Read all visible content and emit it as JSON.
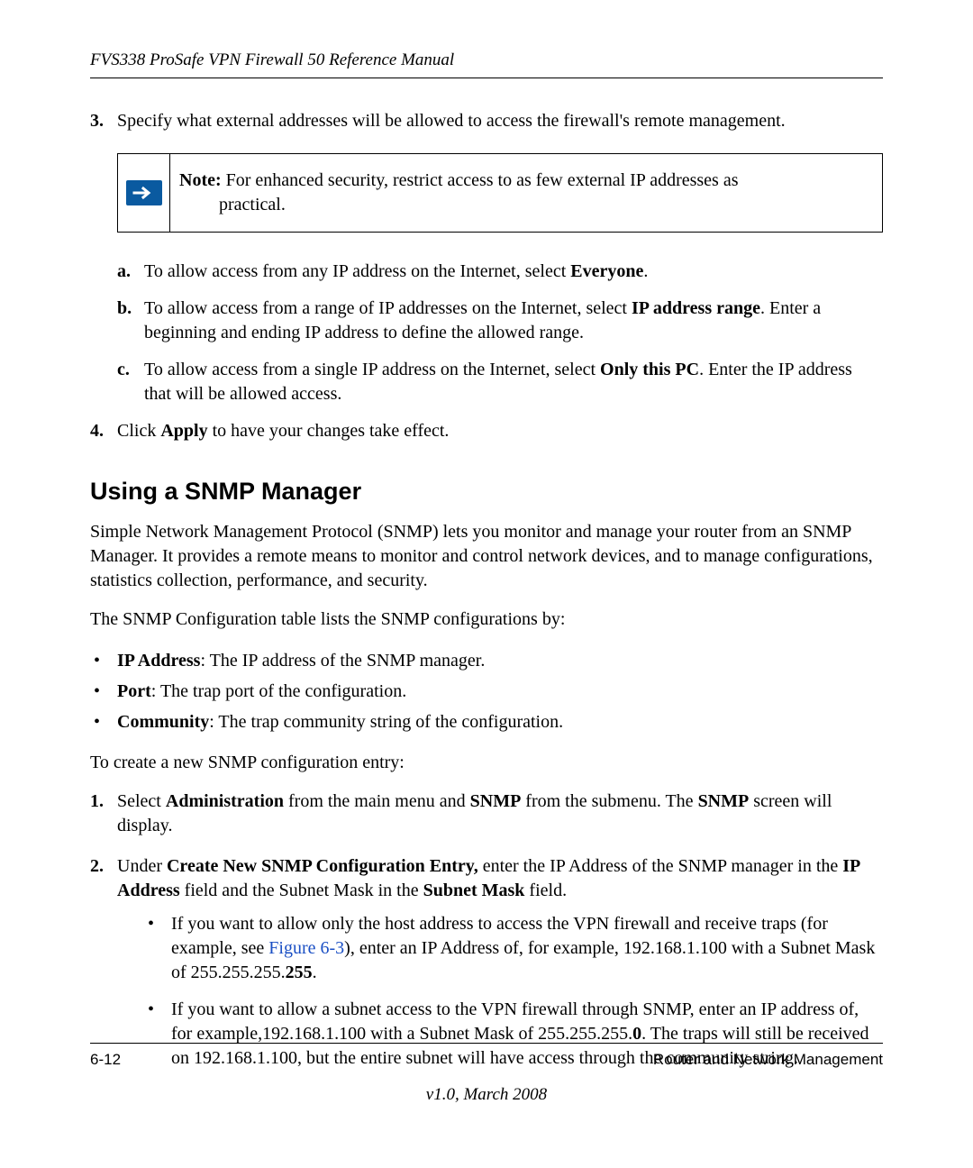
{
  "header": {
    "title": "FVS338 ProSafe VPN Firewall 50 Reference Manual"
  },
  "step3": {
    "marker": "3.",
    "text": "Specify what external addresses will be allowed to access the firewall's remote management."
  },
  "note": {
    "label": "Note:",
    "line1": " For enhanced security, restrict access to as few external IP addresses as",
    "line2": "practical."
  },
  "sub": {
    "a": {
      "marker": "a.",
      "pre": "To allow access from any IP address on the Internet, select ",
      "bold": "Everyone",
      "post": "."
    },
    "b": {
      "marker": "b.",
      "pre": "To allow access from a range of IP addresses on the Internet, select ",
      "bold": "IP address range",
      "post": ". Enter a beginning and ending IP address to define the allowed range."
    },
    "c": {
      "marker": "c.",
      "pre": "To allow access from a single IP address on the Internet, select ",
      "bold": "Only this PC",
      "post": ". Enter the IP address that will be allowed access."
    }
  },
  "step4": {
    "marker": "4.",
    "pre": "Click ",
    "bold": "Apply",
    "post": " to have your changes take effect."
  },
  "section": {
    "title": "Using a SNMP Manager",
    "para1": "Simple Network Management Protocol (SNMP) lets you monitor and manage your router from an SNMP Manager. It provides a remote means to monitor and control network devices, and to manage configurations, statistics collection, performance, and security.",
    "para2": "The SNMP Configuration table lists the SNMP configurations by:"
  },
  "bullets": {
    "marker": "•",
    "b1_bold": "IP Address",
    "b1_rest": ": The IP address of the SNMP manager.",
    "b2_bold": "Port",
    "b2_rest": ": The trap port of the configuration.",
    "b3_bold": "Community",
    "b3_rest": ": The trap community string of the configuration."
  },
  "para_create": "To create a new SNMP configuration entry:",
  "create1": {
    "marker": "1.",
    "s1": "Select ",
    "b1": "Administration",
    "s2": " from the main menu and ",
    "b2": "SNMP",
    "s3": " from the submenu. The ",
    "b3": "SNMP",
    "s4": " screen will display."
  },
  "create2": {
    "marker": "2.",
    "s1": "Under ",
    "b1": "Create New SNMP Configuration Entry,",
    "s2": " enter the IP Address of the SNMP manager in the ",
    "b2": "IP Address",
    "s3": " field and the Subnet Mask in the ",
    "b3": "Subnet Mask",
    "s4": " field."
  },
  "nested": {
    "nb1_s1": "If you want to allow only the host address to access the VPN firewall and receive traps (for example, see ",
    "nb1_link": "Figure 6-3",
    "nb1_s2": "), enter an IP Address of, for example, 192.168.1.100 with a Subnet Mask of 255.255.255.",
    "nb1_b": "255",
    "nb1_s3": ".",
    "nb2_s1": "If you want to allow a subnet access to the VPN firewall through SNMP, enter an IP address of, for example,192.168.1.100 with a Subnet Mask of 255.255.255.",
    "nb2_b": "0",
    "nb2_s2": ". The traps will still be received on 192.168.1.100, but the entire subnet will have access through the community string."
  },
  "footer": {
    "page": "6-12",
    "chapter": "Router and Network Management",
    "version": "v1.0, March 2008"
  }
}
